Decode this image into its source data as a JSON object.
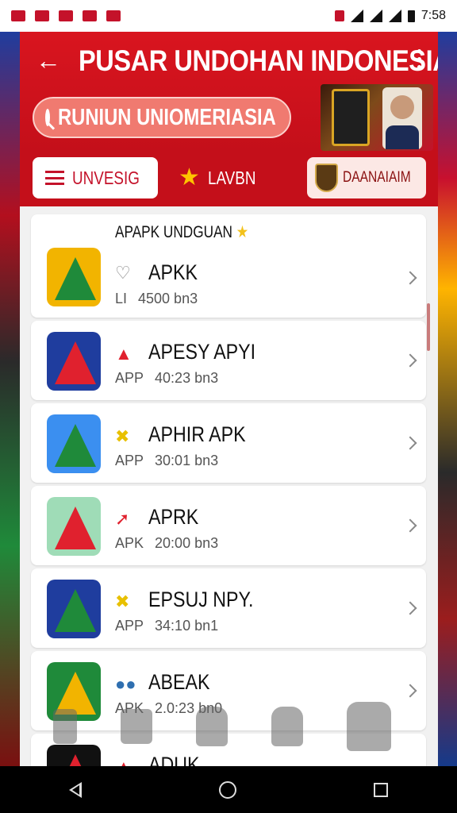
{
  "status_bar": {
    "time": "7:58"
  },
  "app_bar": {
    "title": "PUSAR UNDOHAN INDONESIA",
    "search_text": "RUNIUN UNIOMERIASIA"
  },
  "tabs": [
    {
      "label": "UNVESIG"
    },
    {
      "label": "LAVBN"
    },
    {
      "label": "DAANAIAIM"
    }
  ],
  "list": {
    "section_title": "APAPK UNDGUAN",
    "items": [
      {
        "name": "APKK",
        "type": "LI",
        "size": "4500 bn3",
        "icon_color": "#f2b400",
        "accent": "#1f8a3a"
      },
      {
        "name": "APESY APYI",
        "type": "APP",
        "size": "40:23 bn3",
        "icon_color": "#1f3d9e",
        "accent": "#e0212e"
      },
      {
        "name": "APHIR APK",
        "type": "APP",
        "size": "30:01 bn3",
        "icon_color": "#3b8ff0",
        "accent": "#f2b400"
      },
      {
        "name": "APRK",
        "type": "APK",
        "size": "20:00 bn3",
        "icon_color": "#9fdcb7",
        "accent": "#e0212e"
      },
      {
        "name": "EPSUJ NPY.",
        "type": "APP",
        "size": "34:10 bn1",
        "icon_color": "#1f3d9e",
        "accent": "#1f8a3a"
      },
      {
        "name": "ABEAK",
        "type": "APK",
        "size": "2.0:23 bn0",
        "icon_color": "#1f8a3a",
        "accent": "#f2b400"
      },
      {
        "name": "ADUK",
        "type": "",
        "size": "",
        "icon_color": "#111111",
        "accent": "#e0212e"
      }
    ]
  },
  "colors": {
    "primary": "#c4122a",
    "star": "#ffc400"
  }
}
